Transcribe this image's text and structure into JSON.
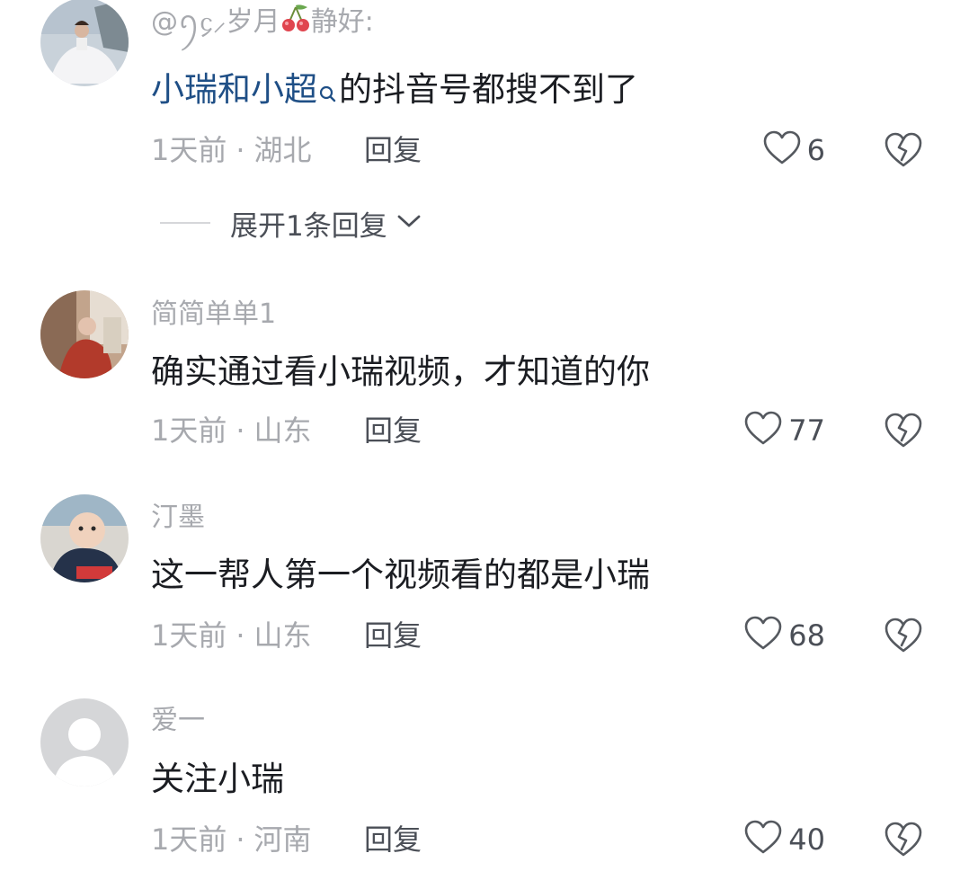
{
  "comments": [
    {
      "username": "@ꪆ᧔⸝岁月",
      "username_tail": "静好:",
      "username_emoji": "cherry-icon",
      "content_link": "小瑞和小超",
      "content_rest": "的抖音号都搜不到了",
      "time": "1天前",
      "location": "湖北",
      "reply_label": "回复",
      "likes": "6",
      "expand_label": "展开1条回复"
    },
    {
      "username": "简简单单1",
      "content": "确实通过看小瑞视频，才知道的你",
      "time": "1天前",
      "location": "山东",
      "reply_label": "回复",
      "likes": "77"
    },
    {
      "username": "汀墨",
      "content": "这一帮人第一个视频看的都是小瑞",
      "time": "1天前",
      "location": "山东",
      "reply_label": "回复",
      "likes": "68"
    },
    {
      "username": "爱一",
      "content": "关注小瑞",
      "time": "1天前",
      "location": "河南",
      "reply_label": "回复",
      "likes": "40"
    }
  ],
  "meta_separator": "·",
  "colors": {
    "link": "#1f4f86",
    "secondary_text": "#a7a9ae",
    "primary_text": "#1b1d22",
    "action_text": "#4b4f57"
  }
}
